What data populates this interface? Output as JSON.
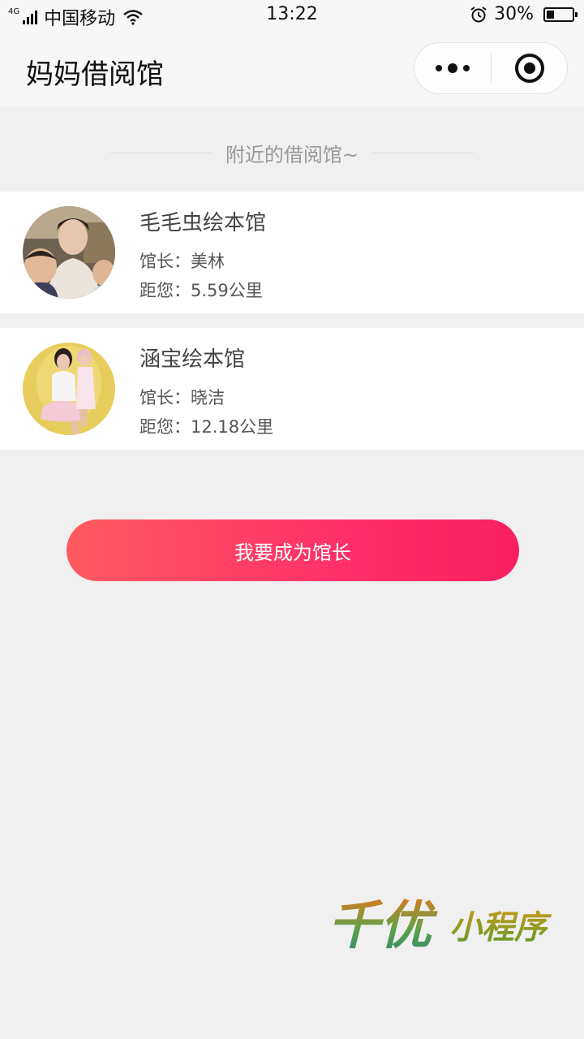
{
  "status_bar": {
    "network_type": "4G",
    "carrier": "中国移动",
    "time": "13:22",
    "battery_percent": "30%",
    "battery_level": 0.3,
    "icons": [
      "signal-icon",
      "wifi-icon",
      "alarm-icon",
      "battery-icon"
    ]
  },
  "nav": {
    "title": "妈妈借阅馆",
    "icons": [
      "more-icon",
      "close-icon"
    ]
  },
  "section": {
    "title": "附近的借阅馆~"
  },
  "libraries": [
    {
      "name": "毛毛虫绘本馆",
      "owner": "馆长：美林",
      "distance": "距您：5.59公里"
    },
    {
      "name": "涵宝绘本馆",
      "owner": "馆长：晓洁",
      "distance": "距您：12.18公里"
    }
  ],
  "cta": {
    "label": "我要成为馆长",
    "gradient_start": "#ff5a5f",
    "gradient_end": "#f81f5f"
  },
  "watermark": {
    "text": "千优小程序"
  },
  "colors": {
    "background": "#f0f0f0",
    "navbar": "#f7f7f7",
    "card": "#ffffff",
    "accent": "#ff2d6a"
  }
}
